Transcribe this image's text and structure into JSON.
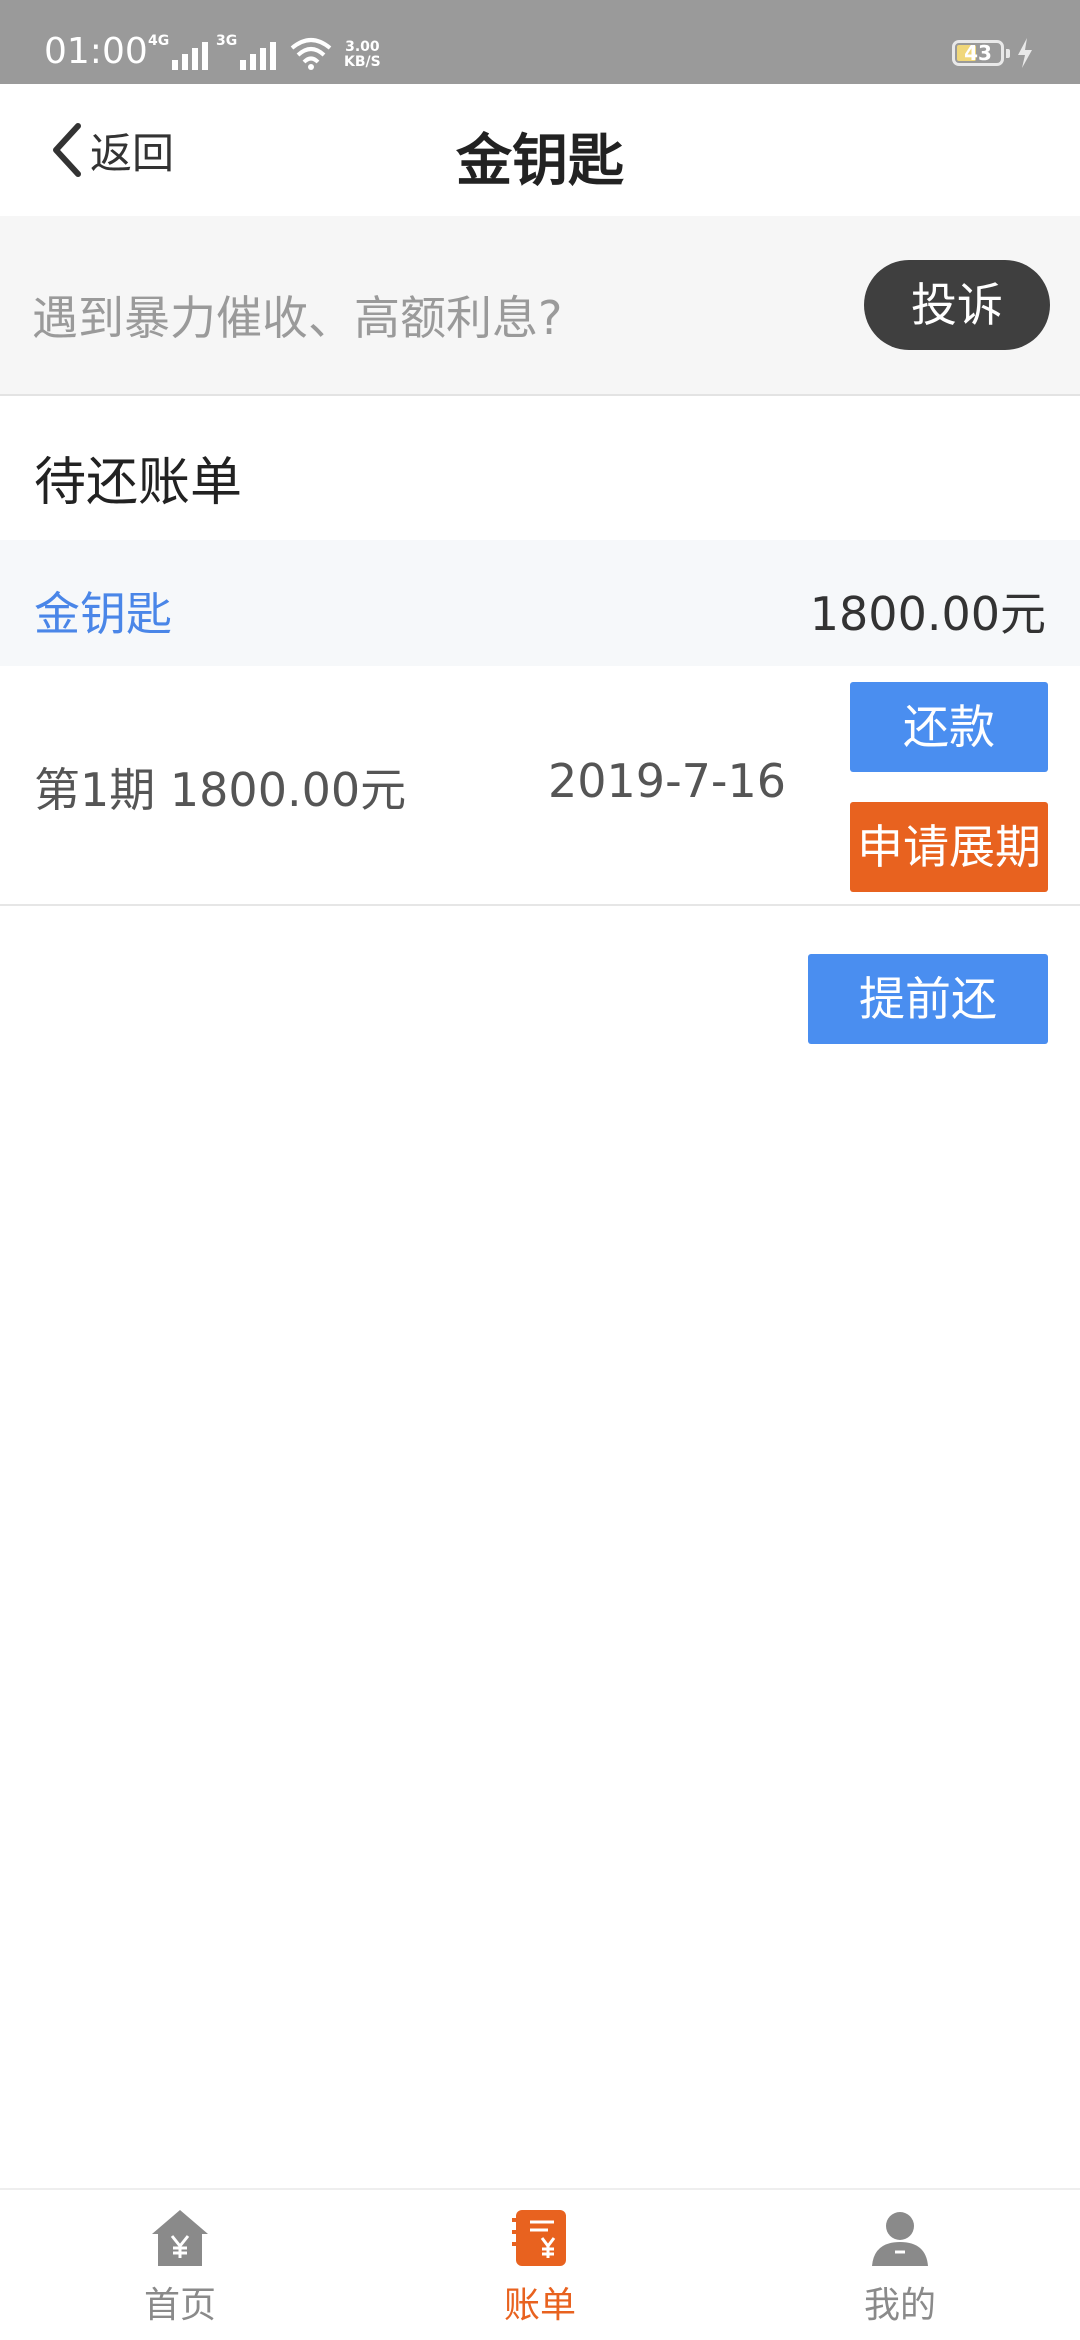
{
  "status_bar": {
    "time": "01:00",
    "network_1": "4G",
    "network_2": "3G",
    "speed_value": "3.00",
    "speed_unit": "KB/S",
    "battery": "43"
  },
  "header": {
    "back_label": "返回",
    "title": "金钥匙",
    "icons": {
      "back": "chevron-left-icon"
    }
  },
  "complaint": {
    "prompt": "遇到暴力催收、高额利息?",
    "button_label": "投诉"
  },
  "bills": {
    "section_title": "待还账单",
    "loan": {
      "name": "金钥匙",
      "total": "1800.00元"
    },
    "installments": [
      {
        "label": "第1期  1800.00元",
        "due_date": "2019-7-16",
        "repay_label": "还款",
        "extend_label": "申请展期"
      }
    ],
    "early_repay_label": "提前还"
  },
  "tabbar": {
    "items": [
      {
        "label": "首页",
        "icon": "home-yen-icon",
        "active": false
      },
      {
        "label": "账单",
        "icon": "bill-yen-icon",
        "active": true
      },
      {
        "label": "我的",
        "icon": "user-icon",
        "active": false
      }
    ]
  },
  "colors": {
    "accent_blue": "#4a8ef0",
    "accent_orange": "#e8621f",
    "link_blue": "#4a86e8",
    "status_bar": "#9a9a9a"
  }
}
